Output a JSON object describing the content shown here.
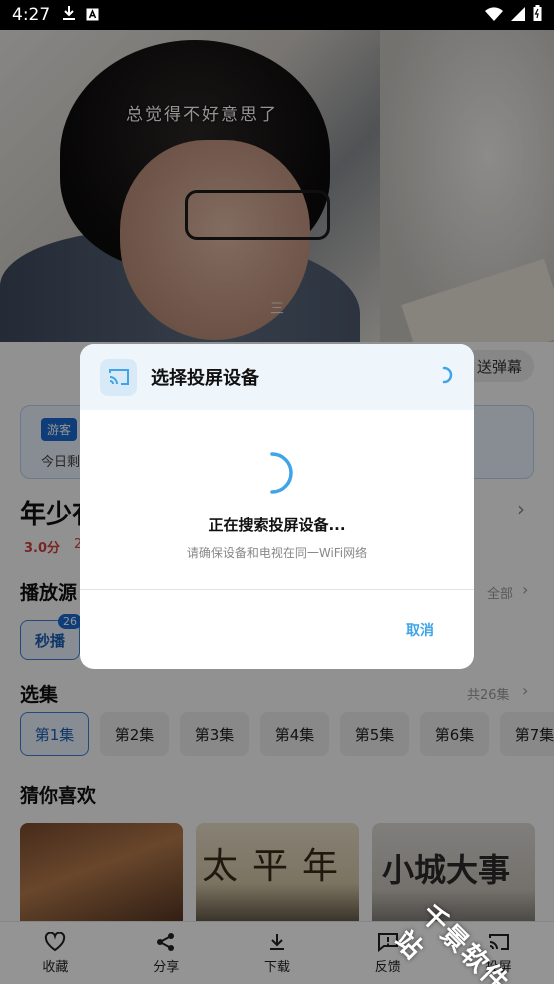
{
  "status_bar": {
    "time": "4:27"
  },
  "video": {
    "subtitle": "总觉得不好意思了",
    "mark": "三"
  },
  "page": {
    "danmu_label": "送弹幕",
    "vip": {
      "tag": "游客",
      "text": "今日剩"
    },
    "title": "年少有",
    "score": "3.0分",
    "score_extra": "2",
    "source_section": "播放源",
    "source_more": "全部",
    "source_button": "秒播",
    "source_badge": "26",
    "episodes_section": "选集",
    "episodes_total": "共26集",
    "episodes": [
      "第1集",
      "第2集",
      "第3集",
      "第4集",
      "第5集",
      "第6集",
      "第7集"
    ],
    "recommend_section": "猜你喜欢",
    "posters": [
      {
        "text": ""
      },
      {
        "text": "太平年"
      },
      {
        "text": "小城大事"
      }
    ]
  },
  "bottom_bar": {
    "items": [
      {
        "label": "收藏",
        "icon": "heart-icon"
      },
      {
        "label": "分享",
        "icon": "share-icon"
      },
      {
        "label": "下载",
        "icon": "download-icon"
      },
      {
        "label": "反馈",
        "icon": "feedback-icon"
      },
      {
        "label": "投屏",
        "icon": "cast-icon"
      }
    ]
  },
  "dialog": {
    "title": "选择投屏设备",
    "searching": "正在搜索投屏设备...",
    "hint": "请确保设备和电视在同一WiFi网络",
    "cancel": "取消"
  },
  "watermark": "千景软件站",
  "colors": {
    "accent": "#3fa4e8",
    "brand_blue": "#1a69d1",
    "dim": "rgba(0,0,0,0.42)"
  }
}
